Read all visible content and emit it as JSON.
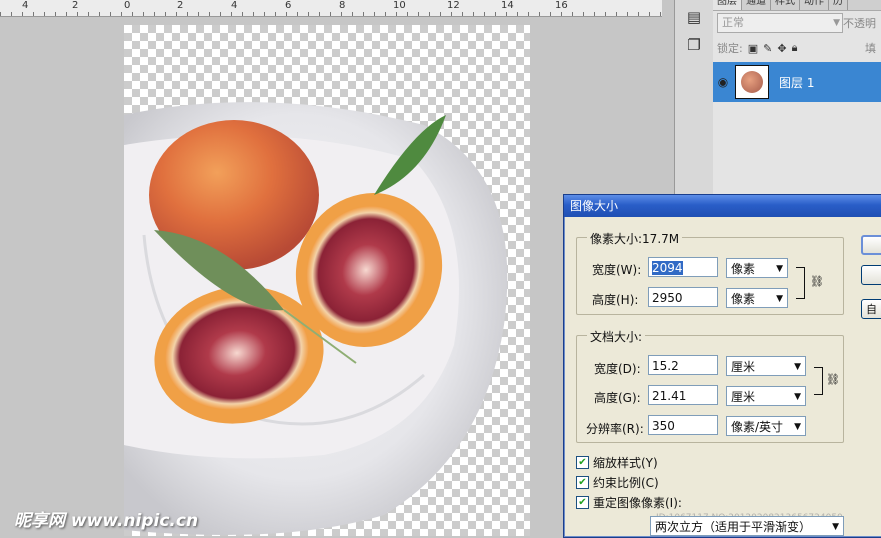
{
  "ruler": {
    "marks": [
      "4",
      "2",
      "0",
      "2",
      "4",
      "6",
      "8",
      "10",
      "12",
      "14",
      "16"
    ]
  },
  "watermark": "昵享网 www.nipic.cn",
  "dock": {
    "icons": [
      "layers-panel-icon",
      "history-panel-icon"
    ]
  },
  "layers_panel": {
    "tabs": [
      "图层",
      "通道",
      "样式",
      "动作",
      "历"
    ],
    "blend_mode": "正常",
    "opacity_label": "不透明",
    "lock_label": "锁定:",
    "fill_label": "填",
    "layer": {
      "name": "图层 1"
    }
  },
  "dialog": {
    "title": "图像大小",
    "pixel_group": {
      "title": "像素大小:17.7M",
      "width_label": "宽度(W):",
      "width_value": "2094",
      "width_unit": "像素",
      "height_label": "高度(H):",
      "height_value": "2950",
      "height_unit": "像素"
    },
    "doc_group": {
      "title": "文档大小:",
      "width_label": "宽度(D):",
      "width_value": "15.2",
      "width_unit": "厘米",
      "height_label": "高度(G):",
      "height_value": "21.41",
      "height_unit": "厘米",
      "res_label": "分辨率(R):",
      "res_value": "350",
      "res_unit": "像素/英寸"
    },
    "checkboxes": [
      {
        "label": "缩放样式(Y)",
        "checked": true
      },
      {
        "label": "约束比例(C)",
        "checked": true
      },
      {
        "label": "重定图像像素(I):",
        "checked": true
      }
    ],
    "resample_method": "两次立方（适用于平滑渐变）",
    "buttons": [
      "",
      "",
      "自"
    ],
    "overlay_text": "ID:1067117 NO:20120208213656724050"
  }
}
